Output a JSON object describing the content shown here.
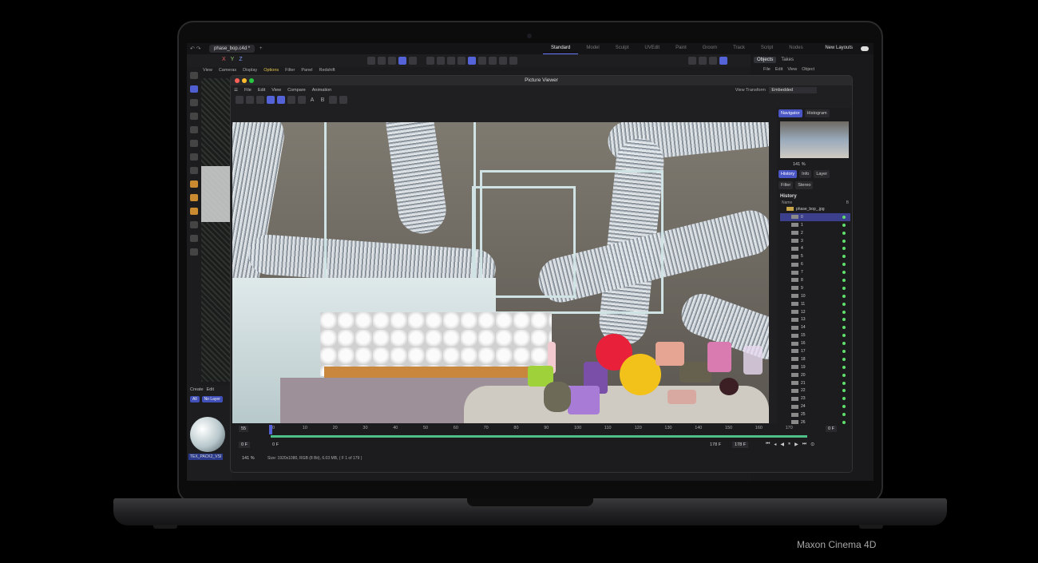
{
  "caption": "Maxon Cinema 4D",
  "app": {
    "file_tab": "phase_bop.c4d *",
    "layouts": [
      "Standard",
      "Model",
      "Sculpt",
      "UVEdit",
      "Paint",
      "Groom",
      "Track",
      "Script",
      "Nodes"
    ],
    "new_layouts": "New Layouts",
    "axes": {
      "x": "X",
      "y": "Y",
      "z": "Z"
    },
    "viewport_menu": [
      "View",
      "Cameras",
      "Display",
      "Options",
      "Filter",
      "Panel",
      "Redshift"
    ],
    "right_tabs": [
      "Objects",
      "Takes"
    ],
    "right_menu": [
      "File",
      "Edit",
      "View",
      "Object"
    ],
    "material_tabs": [
      "Create",
      "Edit"
    ],
    "material_buttons": [
      "All",
      "No Layer"
    ],
    "material_name": "TEX_PACK2_VSI"
  },
  "viewer": {
    "title": "Picture Viewer",
    "menu": [
      "File",
      "Edit",
      "View",
      "Compare",
      "Animation"
    ],
    "view_transform_label": "View Transform",
    "view_transform_value": "Embedded",
    "tool_letters": [
      "A",
      "B"
    ],
    "nav_tabs": [
      "Navigator",
      "Histogram"
    ],
    "zoom": "141 %",
    "info_tabs": [
      "History",
      "Info",
      "Layer"
    ],
    "info_tabs2": [
      "Filter",
      "Stereo"
    ],
    "history_title": "History",
    "history_col_name": "Name",
    "history_col_b": "B",
    "history_folder": "phase_bop_.jpg",
    "history_items": [
      "0",
      "1",
      "2",
      "3",
      "4",
      "5",
      "6",
      "7",
      "8",
      "9",
      "10",
      "11",
      "12",
      "13",
      "14",
      "15",
      "16",
      "17",
      "18",
      "19",
      "20",
      "21",
      "22",
      "23",
      "24",
      "25",
      "26"
    ],
    "timeline_ticks": [
      "0",
      "10",
      "20",
      "30",
      "40",
      "50",
      "60",
      "70",
      "80",
      "90",
      "100",
      "110",
      "120",
      "130",
      "140",
      "150",
      "160",
      "170"
    ],
    "frame_left": "55",
    "frame_right": "0 F",
    "current_frame": "0 F",
    "start_frame": "0 F",
    "end_frame": "178 F",
    "end_frame_box": "178 F",
    "zoom_bottom": "141 %",
    "status_text": "Size: 1920x1080, RGB (8 Bit), 6.03 MB,  ( F 1 of 179 )"
  }
}
